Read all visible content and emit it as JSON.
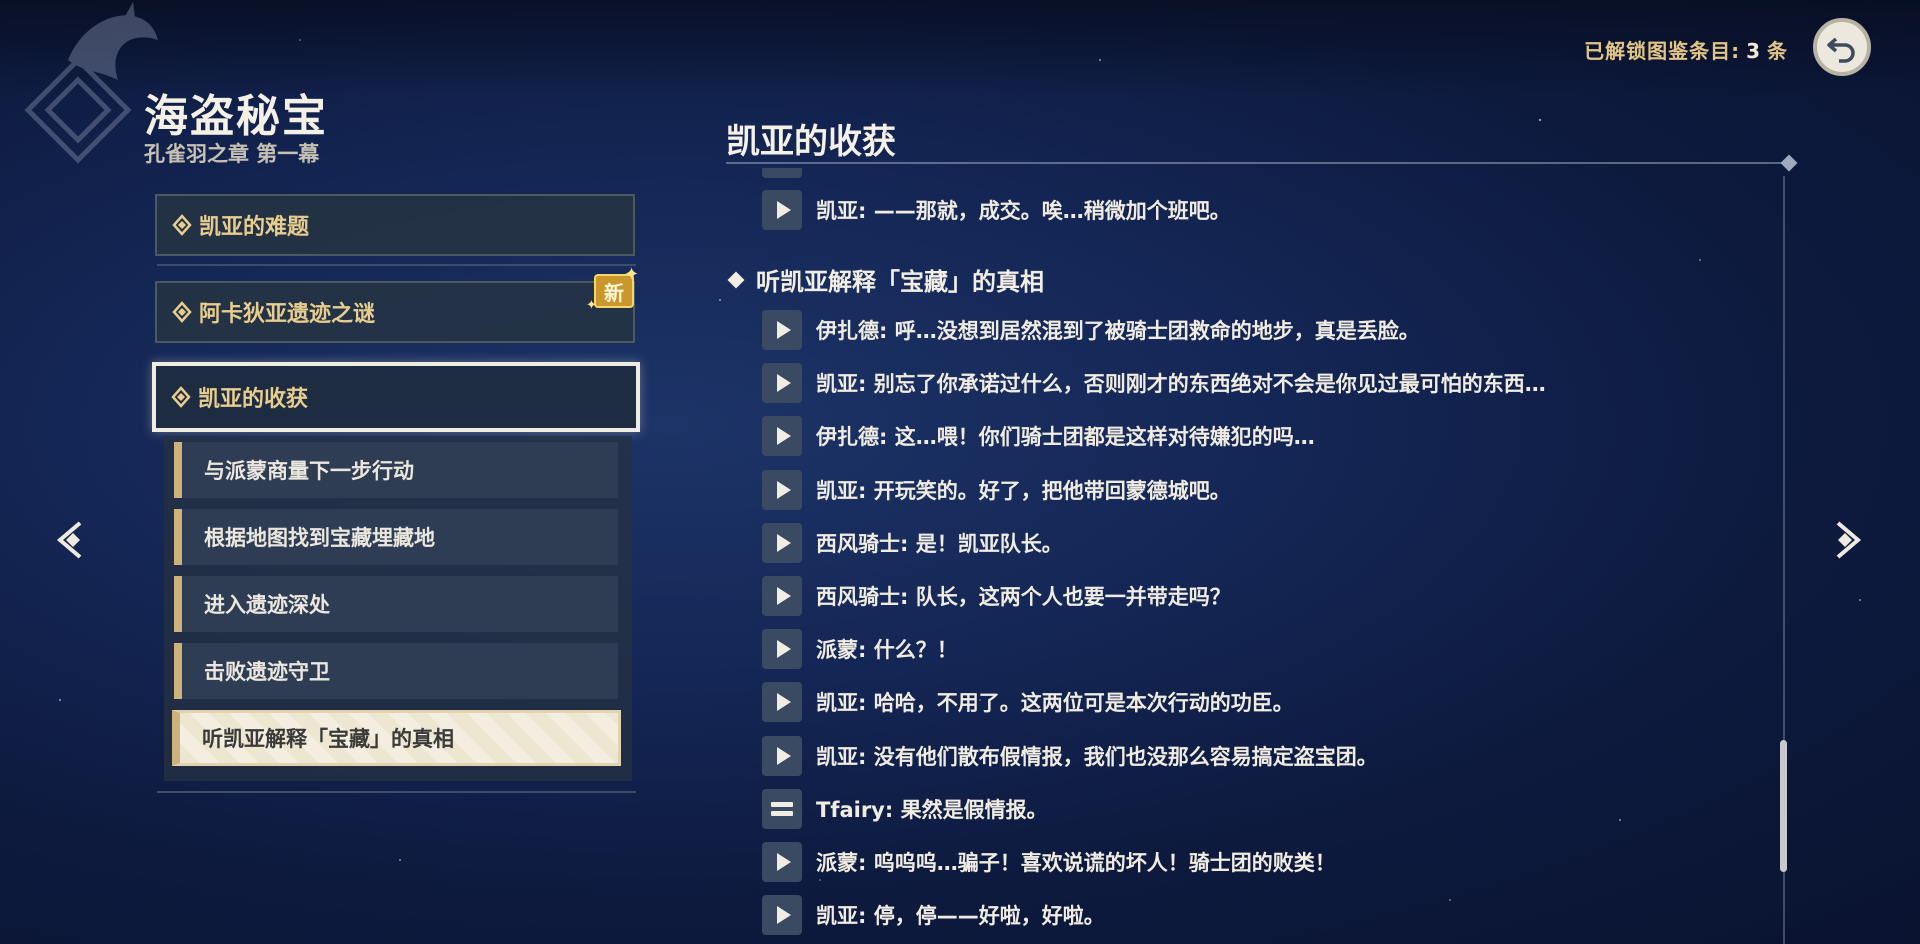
{
  "book": {
    "title": "海盗秘宝",
    "subtitle": "孔雀羽之章 第一幕"
  },
  "header": {
    "unlock_label": "已解锁图鉴条目:",
    "unlock_count": "3",
    "unlock_unit": "条"
  },
  "chapters": [
    {
      "label": "凯亚的难题"
    },
    {
      "label": "阿卡狄亚遗迹之谜",
      "badge": "新"
    },
    {
      "label": "凯亚的收获"
    }
  ],
  "sub_items": [
    {
      "label": "与派蒙商量下一步行动"
    },
    {
      "label": "根据地图找到宝藏埋藏地"
    },
    {
      "label": "进入遗迹深处"
    },
    {
      "label": "击败遗迹守卫"
    },
    {
      "label": "听凯亚解释「宝藏」的真相"
    }
  ],
  "content": {
    "title": "凯亚的收获",
    "first_line": "凯亚: ——那就，成交。唉…稍微加个班吧。",
    "section_header": "听凯亚解释「宝藏」的真相",
    "lines": [
      {
        "text": "伊扎德: 呼…没想到居然混到了被骑士团救命的地步，真是丢脸。",
        "icon": "play"
      },
      {
        "text": "凯亚: 别忘了你承诺过什么，否则刚才的东西绝对不会是你见过最可怕的东西…",
        "icon": "play"
      },
      {
        "text": "伊扎德: 这…喂！你们骑士团都是这样对待嫌犯的吗…",
        "icon": "play"
      },
      {
        "text": "凯亚: 开玩笑的。好了，把他带回蒙德城吧。",
        "icon": "play"
      },
      {
        "text": "西风骑士: 是！凯亚队长。",
        "icon": "play"
      },
      {
        "text": "西风骑士: 队长，这两个人也要一并带走吗？",
        "icon": "play"
      },
      {
        "text": "派蒙: 什么？！",
        "icon": "play"
      },
      {
        "text": "凯亚: 哈哈，不用了。这两位可是本次行动的功臣。",
        "icon": "play"
      },
      {
        "text": "凯亚: 没有他们散布假情报，我们也没那么容易搞定盗宝团。",
        "icon": "play"
      },
      {
        "text": "Tfairy: 果然是假情报。",
        "icon": "text"
      },
      {
        "text": "派蒙: 呜呜呜…骗子！喜欢说谎的坏人！骑士团的败类！",
        "icon": "play"
      },
      {
        "text": "凯亚: 停，停——好啦，好啦。",
        "icon": "play"
      }
    ]
  },
  "icons": {
    "back": "return-arrow-icon",
    "prev": "chevron-left-icon",
    "next": "chevron-right-icon",
    "chapter": "diamond-icon",
    "play": "play-icon",
    "text": "text-lines-icon"
  },
  "colors": {
    "background": "#142655",
    "gold": "#e7cd8e",
    "active_border": "#efece2",
    "sub_accent": "#cdb27c"
  }
}
